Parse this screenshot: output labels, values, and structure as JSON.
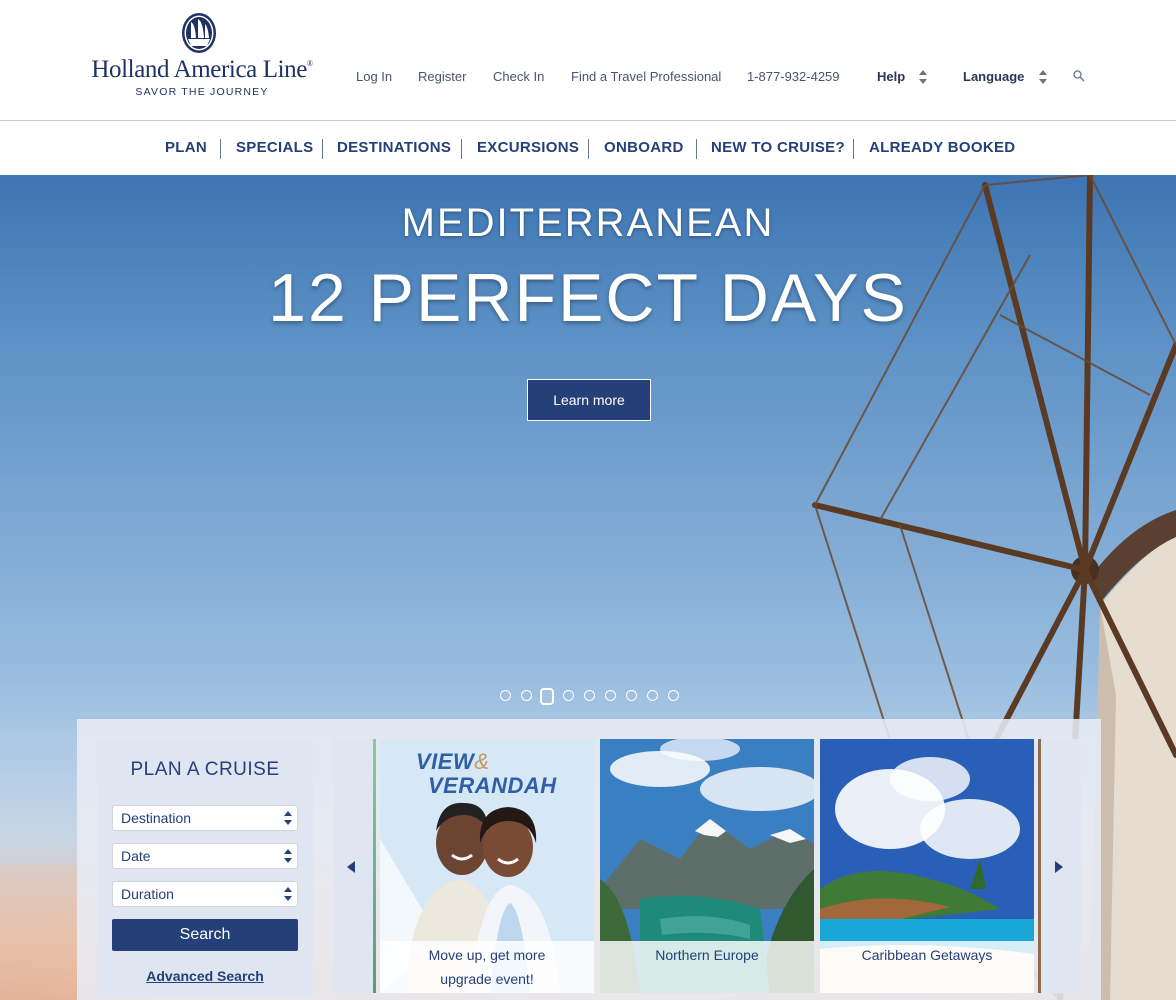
{
  "brand": {
    "name": "Holland America Line",
    "tagline": "SAVOR THE JOURNEY"
  },
  "utility_nav": {
    "log_in": "Log In",
    "register": "Register",
    "check_in": "Check In",
    "find_travel_pro": "Find a Travel Professional",
    "phone": "1-877-932-4259",
    "help": "Help",
    "language": "Language"
  },
  "main_nav": {
    "items": [
      "PLAN",
      "SPECIALS",
      "DESTINATIONS",
      "EXCURSIONS",
      "ONBOARD",
      "NEW TO CRUISE?",
      "ALREADY BOOKED"
    ]
  },
  "hero": {
    "kicker": "MEDITERRANEAN",
    "title": "12 PERFECT DAYS",
    "cta": "Learn more",
    "slide_count": 9,
    "active_slide": 3
  },
  "plan_cruise": {
    "title": "PLAN A CRUISE",
    "destination": "Destination",
    "date": "Date",
    "duration": "Duration",
    "search": "Search",
    "advanced_search": "Advanced Search"
  },
  "promos": {
    "view_verandah_title_1": "VIEW",
    "view_verandah_amp": "&",
    "view_verandah_title_2": "VERANDAH",
    "cards": [
      {
        "label_line1": "Move up, get more",
        "label_line2": "upgrade event!"
      },
      {
        "label_line1": "Northern Europe",
        "label_line2": ""
      },
      {
        "label_line1": "Caribbean Getaways",
        "label_line2": ""
      }
    ]
  },
  "colors": {
    "brand_navy": "#253f78",
    "nav_text": "#253f78",
    "util_text": "#4a5470"
  },
  "icons": {
    "search": "search-icon",
    "sort": "sort-arrows-icon",
    "prev": "caret-left-icon",
    "next": "caret-right-icon"
  }
}
